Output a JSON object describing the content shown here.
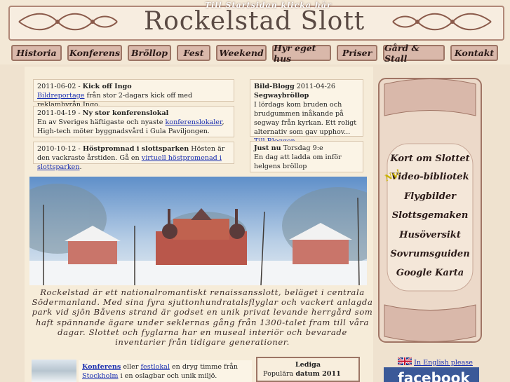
{
  "header": {
    "tagline": "Till Startsidan klicka här",
    "title": "Rockelstad Slott"
  },
  "nav": [
    {
      "label": "Historia"
    },
    {
      "label": "Konferens"
    },
    {
      "label": "Bröllop"
    },
    {
      "label": "Fest"
    },
    {
      "label": "Weekend"
    },
    {
      "label": "Hyr eget hus"
    },
    {
      "label": "Priser"
    },
    {
      "label": "Gård & Stall"
    },
    {
      "label": "Kontakt"
    }
  ],
  "news": {
    "item1": {
      "date": "2011-06-02 -",
      "headline": "Kick off Ingo",
      "link": "Bildreportage",
      "text": " från stor 2-dagars kick off med reklambyrån Ingo."
    },
    "item2": {
      "date": "2011-04-19 -",
      "headline": "Ny stor konferenslokal",
      "text1": "En av Sveriges häftigaste och nyaste ",
      "link": "konferenslokaler",
      "text2": ", High-tech möter byggnadsvård i Gula Paviljongen."
    },
    "item3": {
      "date": "2010-10-12 -",
      "headline": " Höstpromnad i slottsparken",
      "text1": " Hösten är den vackraste årstiden. Gå en ",
      "link": "virtuell höstpromenad i slottsparken",
      "text2": "."
    }
  },
  "blog": {
    "label": "Bild-Blogg",
    "date": " 2011-04-26",
    "headline": "Segwaybröllop",
    "text": "I lördags kom bruden och brudgummen inåkande på segway från kyrkan. Ett roligt alternativ som gav upphov... ",
    "link": "Till Bloggen"
  },
  "justnu": {
    "label": "Just nu",
    "date": " Torsdag 9:e",
    "text": "En dag att ladda om inför helgens bröllop"
  },
  "intro": "Rockelstad är ett nationalromantiskt renaissansslott, beläget i centrala Södermanland. Med sina fyra sjuttonhundratalsflyglar och vackert anlagda park vid sjön Båvens strand är godset en unik privat levande herrgård som haft spännande ägare under seklernas gång från 1300-talet fram till våra dagar. Slottet och fyglarna har en museal interiör och bevarade inventarier från tidigare generationer.",
  "bottom": {
    "link1": "Konferens",
    "t1": " eller ",
    "link2": "festlokal",
    "t2": " en dryg timme från ",
    "link3": "Stockholm",
    "t3": " i en oslagbar och unik miljö."
  },
  "lediga": {
    "title": "Lediga",
    "line_prefix": "Populära ",
    "line_bold": "datum 2011"
  },
  "side_menu": [
    {
      "label": "Kort om Slottet"
    },
    {
      "label": "Video-bibliotek"
    },
    {
      "label": "Flygbilder"
    },
    {
      "label": "Slottsgemaken"
    },
    {
      "label": "Husöversikt"
    },
    {
      "label": "Sovrumsguiden"
    },
    {
      "label": "Google Karta"
    }
  ],
  "ny_badge": "Ny!",
  "english_link": "In English please",
  "facebook": "facebook",
  "colors": {
    "accent": "#9c7565",
    "nav_bg": "#d9b8aa",
    "link": "#1a2fb0",
    "page_bg": "#efe2cf"
  }
}
